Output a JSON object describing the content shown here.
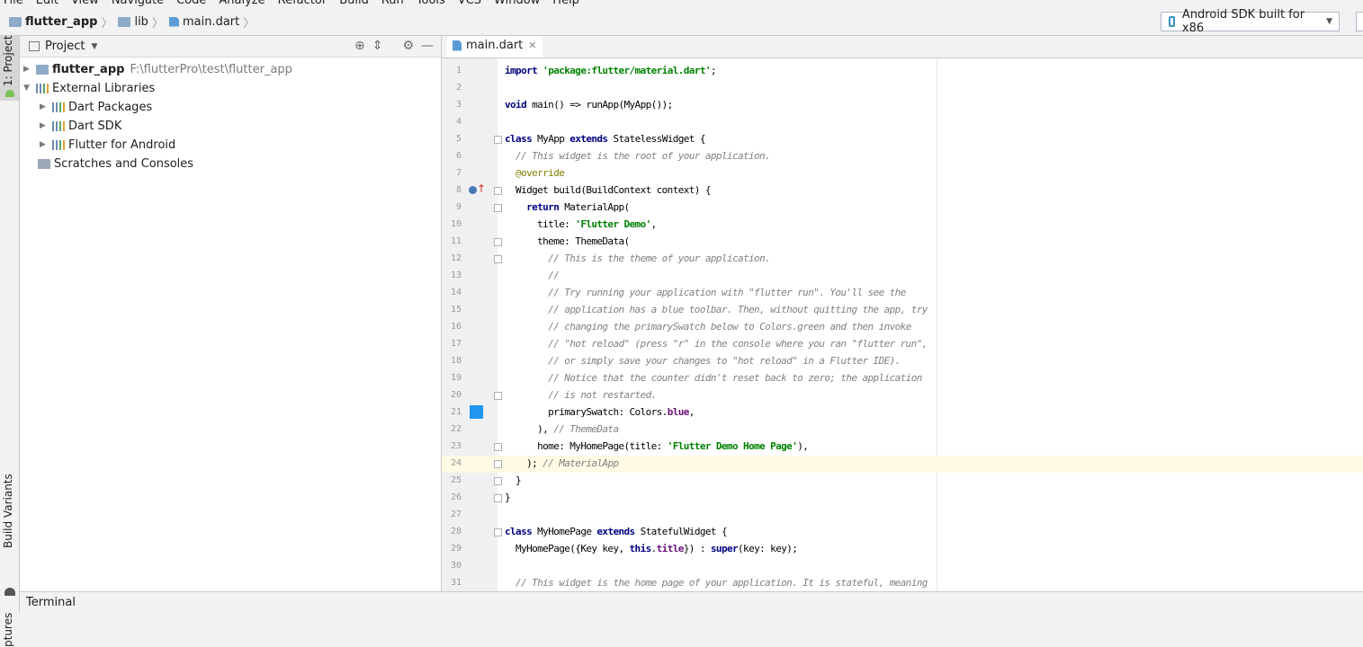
{
  "menu": [
    "File",
    "Edit",
    "View",
    "Navigate",
    "Code",
    "Analyze",
    "Refactor",
    "Build",
    "Run",
    "Tools",
    "VCS",
    "Window",
    "Help"
  ],
  "breadcrumb": {
    "project": "flutter_app",
    "folder": "lib",
    "file": "main.dart"
  },
  "device_selector": {
    "label": "Android SDK built for x86"
  },
  "left_tabs": {
    "project": "1: Project",
    "build_variants": "Build Variants",
    "captures": "ptures"
  },
  "project_panel": {
    "title": "Project",
    "tree": [
      {
        "label": "flutter_app",
        "path": "F:\\flutterPro\\test\\flutter_app"
      },
      {
        "label": "External Libraries"
      },
      {
        "label": "Dart Packages"
      },
      {
        "label": "Dart SDK"
      },
      {
        "label": "Flutter for Android"
      },
      {
        "label": "Scratches and Consoles"
      }
    ]
  },
  "editor": {
    "tab": "main.dart",
    "current_line": 24,
    "lines": [
      "import 'package:flutter/material.dart';",
      "",
      "void main() => runApp(MyApp());",
      "",
      "class MyApp extends StatelessWidget {",
      "  // This widget is the root of your application.",
      "  @override",
      "  Widget build(BuildContext context) {",
      "    return MaterialApp(",
      "      title: 'Flutter Demo',",
      "      theme: ThemeData(",
      "        // This is the theme of your application.",
      "        //",
      "        // Try running your application with \"flutter run\". You'll see the",
      "        // application has a blue toolbar. Then, without quitting the app, try",
      "        // changing the primarySwatch below to Colors.green and then invoke",
      "        // \"hot reload\" (press \"r\" in the console where you ran \"flutter run\",",
      "        // or simply save your changes to \"hot reload\" in a Flutter IDE).",
      "        // Notice that the counter didn't reset back to zero; the application",
      "        // is not restarted.",
      "        primarySwatch: Colors.blue,",
      "      ), // ThemeData",
      "      home: MyHomePage(title: 'Flutter Demo Home Page'),",
      "    ); // MaterialApp",
      "  }",
      "}",
      "",
      "class MyHomePage extends StatefulWidget {",
      "  MyHomePage({Key key, this.title}) : super(key: key);",
      "",
      "  // This widget is the home page of your application. It is stateful, meaning"
    ]
  },
  "bottom": {
    "terminal": "Terminal"
  },
  "colors": {
    "swatch": "#2196f3",
    "keyword": "#000080",
    "string": "#008000",
    "comment": "#808080"
  }
}
